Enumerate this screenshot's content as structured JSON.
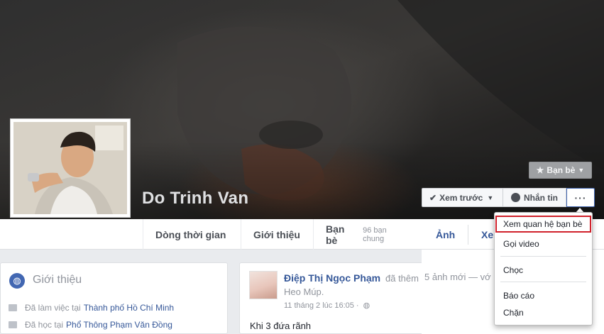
{
  "profile": {
    "name": "Do Trinh Van"
  },
  "header_buttons": {
    "friend_label": "Bạn bè",
    "following_label": "Xem trước",
    "message_label": "Nhắn tin",
    "more_label": "···"
  },
  "tabs": {
    "timeline": "Dòng thời gian",
    "about": "Giới thiệu",
    "friends": "Bạn bè",
    "friends_sub": "96 bạn chung"
  },
  "right_tabs": {
    "photos": "Ảnh",
    "more": "Xem"
  },
  "intro": {
    "title": "Giới thiệu",
    "work_prefix": "Đã làm việc tại",
    "work_place": "Thành phố Hồ Chí Minh",
    "school_prefix": "Đã học tại",
    "school_place": "Phổ Thông Phạm Văn Đồng"
  },
  "post": {
    "author": "Điệp Thị Ngọc Phạm",
    "action": "đã thêm",
    "action_overflow": "5 ảnh mới — vớ",
    "album": "Heo Múp.",
    "time": "11 tháng 2 lúc 16:05 ·",
    "text": "Khi 3 đứa rãnh"
  },
  "dropdown": {
    "view_relationship": "Xem quan hệ bạn bè",
    "video_call": "Gọi video",
    "poke": "Chọc",
    "report": "Báo cáo",
    "block": "Chặn"
  },
  "icons": {
    "check": "check-icon",
    "caret": "caret-down-icon",
    "messenger": "messenger-icon",
    "star": "star-icon",
    "globe": "globe-icon",
    "briefcase": "briefcase-icon",
    "graduation": "graduation-cap-icon"
  },
  "colors": {
    "link": "#365899",
    "highlight_border": "#d0212b",
    "accent": "#4267b2"
  }
}
